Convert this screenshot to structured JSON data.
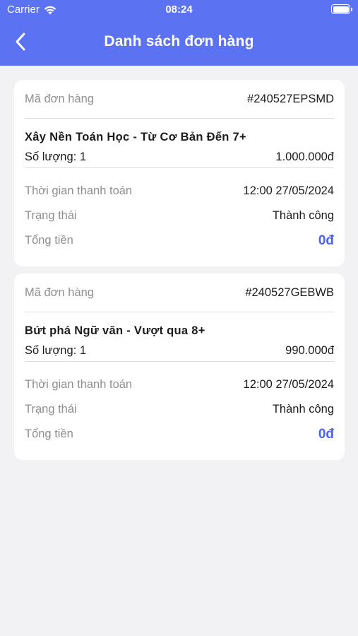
{
  "status_bar": {
    "carrier": "Carrier",
    "time": "08:24"
  },
  "header": {
    "title": "Danh sách đơn hàng",
    "back_icon": "chevron-left-icon"
  },
  "colors": {
    "primary": "#5b72f2",
    "total": "#4a63e8",
    "background": "#f2f2f4"
  },
  "orders": [
    {
      "code_label": "Mã đơn hàng",
      "code": "#240527EPSMD",
      "course_name": "Xây Nền Toán Học - Từ Cơ Bản Đến 7+",
      "quantity": "Số lượng: 1",
      "price": "1.000.000đ",
      "paid_time_label": "Thời gian thanh toán",
      "paid_time": "12:00 27/05/2024",
      "status_label": "Trạng thái",
      "status": "Thành công",
      "total_label": "Tổng tiền",
      "total": "0đ"
    },
    {
      "code_label": "Mã đơn hàng",
      "code": "#240527GEBWB",
      "course_name": "Bứt phá Ngữ văn - Vượt qua 8+",
      "quantity": "Số lượng: 1",
      "price": "990.000đ",
      "paid_time_label": "Thời gian thanh toán",
      "paid_time": "12:00 27/05/2024",
      "status_label": "Trạng thái",
      "status": "Thành công",
      "total_label": "Tổng tiền",
      "total": "0đ"
    }
  ]
}
